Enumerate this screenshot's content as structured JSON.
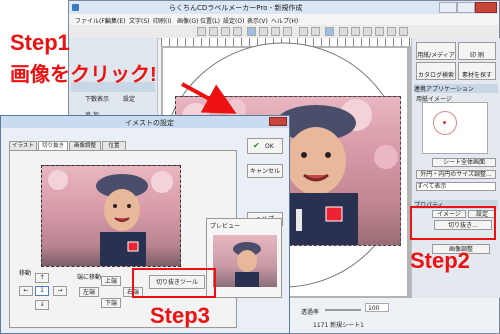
{
  "app": {
    "title": "らくちんCDラベルメーカーPro - 新規作成",
    "menu": [
      "ファイル(F)",
      "編集(E)",
      "文字(S)",
      "印刷(I)",
      "画像(G)",
      "位置(L)",
      "設定(O)",
      "表示(V)",
      "ヘルプ(H)"
    ]
  },
  "left_panel": {
    "rows": [
      {
        "a": "下敷表示",
        "b": "設定"
      },
      {
        "a": "追 加",
        "b": ""
      }
    ]
  },
  "right_panel": {
    "buttons": [
      "用紙/メディア",
      "印 刷",
      "カタログ検索",
      "素材を探す"
    ],
    "section_title": "連携アプリケーション",
    "preview_label": "用紙イメージ",
    "whole_view_button": "シート全体画面",
    "size_adjust_button": "外円・内円のサイズ調整...",
    "display_select": "すべて表示",
    "properties_label": "プロパティ",
    "image_tab": "イメージ",
    "settings_tab": "設定",
    "crop_button": "切り抜き...",
    "image_adjust_button": "画像調整"
  },
  "dialog": {
    "title": "イメストの設定",
    "tabs": [
      "イラスト",
      "切り抜き",
      "画像調整",
      "位置"
    ],
    "ok_button": "OK",
    "cancel_button": "キャンセル",
    "help_button": "ヘルプ",
    "preview_label": "プレビュー",
    "move_label": "移動",
    "move_field_value": "1",
    "edge_label": "端に移動",
    "up_button": "上端",
    "left_button": "左端",
    "right_button": "右端",
    "down_button": "下端",
    "crop_tool_button": "切り抜きツール"
  },
  "status_bar": {
    "transparency_label": "透過率",
    "zoom_value": "100",
    "sheet_label": "1171 新規シート1"
  },
  "annotations": {
    "step1_line1": "Step1",
    "step1_line2": "画像をクリック!",
    "step2": "Step2",
    "step3": "Step3"
  },
  "colors": {
    "annotation_red": "#ee1111",
    "accent_blue": "#1f5ea8",
    "titlebar_blue": "#c9dcef"
  },
  "icons": [
    "app-icon",
    "ok-check-icon",
    "arrow-up-icon",
    "arrow-left-icon",
    "arrow-right-icon",
    "arrow-down-icon",
    "annotation-arrow-icon"
  ]
}
